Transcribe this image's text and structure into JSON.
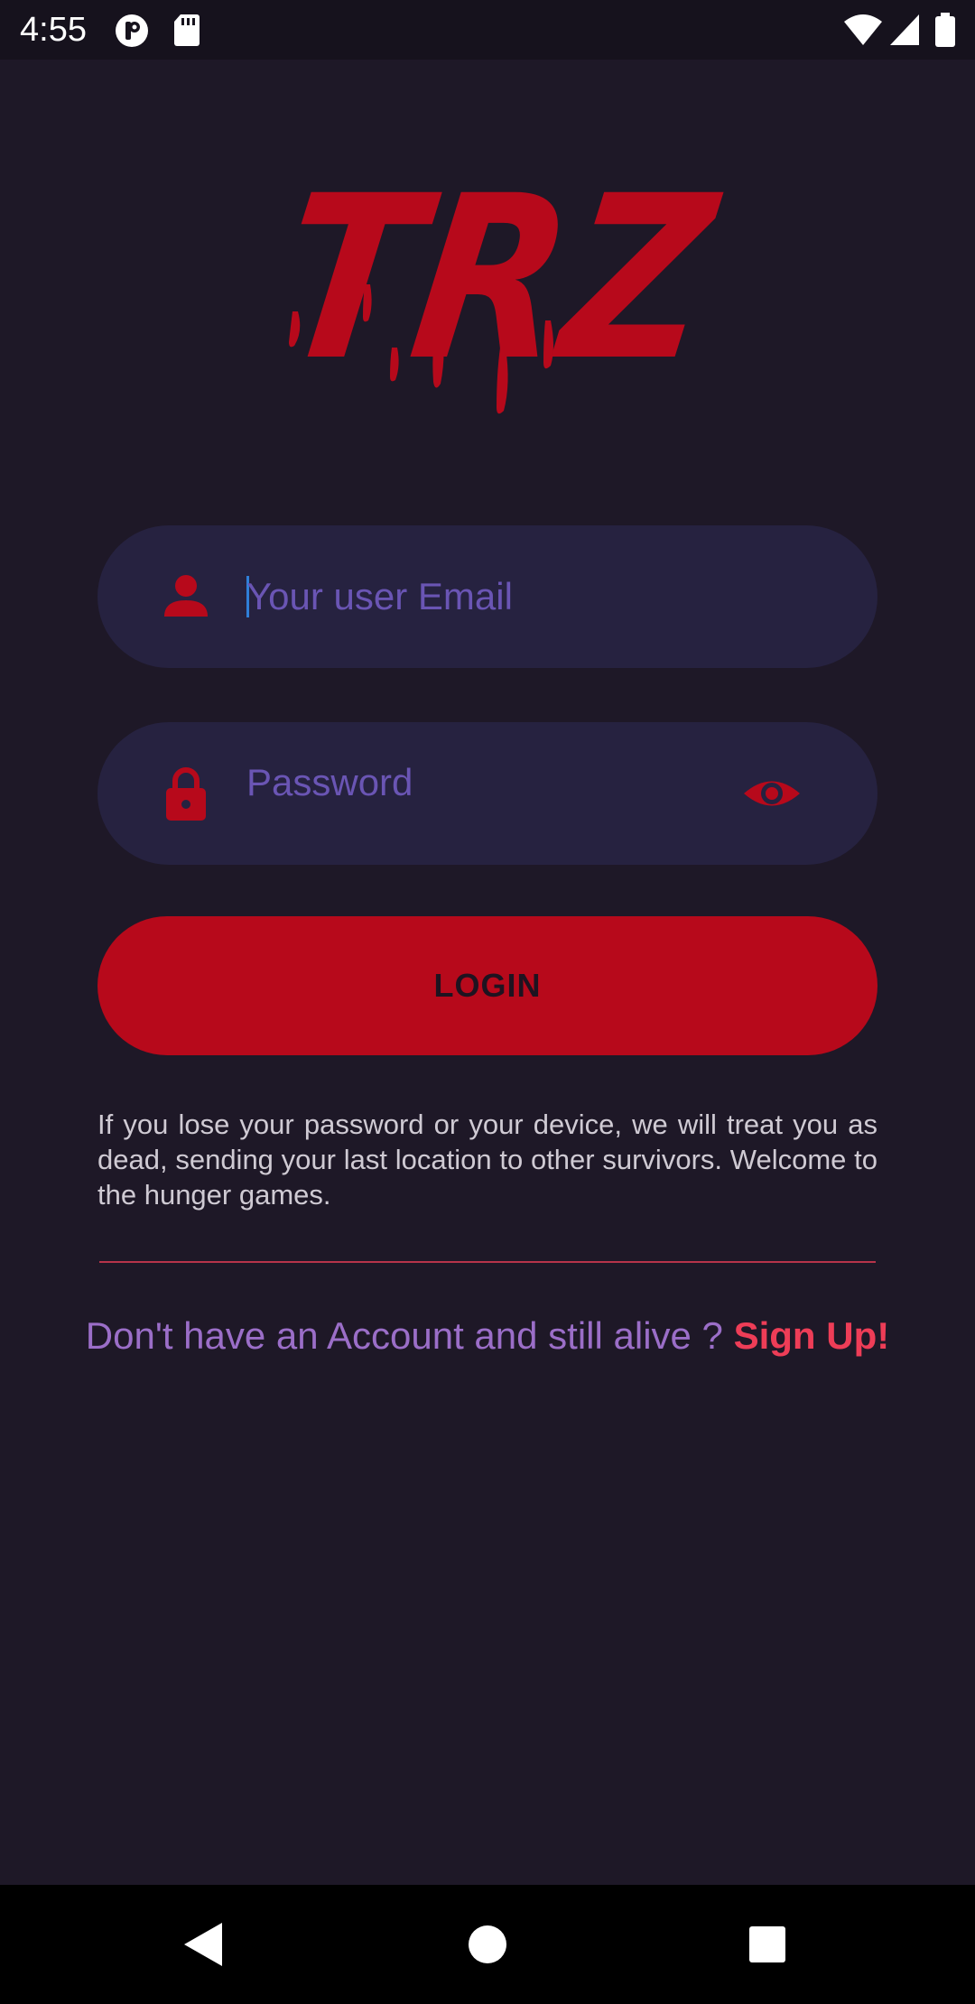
{
  "status_bar": {
    "time": "4:55",
    "icons": [
      "notification-p-icon",
      "sd-card-icon",
      "wifi-icon",
      "cell-signal-icon",
      "battery-icon"
    ]
  },
  "logo": {
    "text": "TRZ",
    "color": "#b7091b"
  },
  "login_form": {
    "email": {
      "placeholder": "Your user Email",
      "value": "",
      "icon": "person-icon"
    },
    "password": {
      "placeholder": "Password",
      "value": "",
      "icon": "lock-icon",
      "toggle_icon": "eye-icon"
    },
    "login_label": "LOGIN"
  },
  "notice": "If you lose your password or your device, we will treat you as dead, sending your last location to other survivors. Welcome to the hunger games.",
  "signup": {
    "prompt": "Don't have an Account and still alive ? ",
    "link": "Sign Up!"
  },
  "nav_bar": {
    "icons": [
      "back-icon",
      "home-icon",
      "recents-icon"
    ]
  },
  "colors": {
    "background": "#1e1827",
    "accent": "#b7091b",
    "field_background": "#262240",
    "placeholder": "#6a55b4",
    "signup_prompt": "#9b6ec8",
    "signup_link": "#ee3d57"
  }
}
